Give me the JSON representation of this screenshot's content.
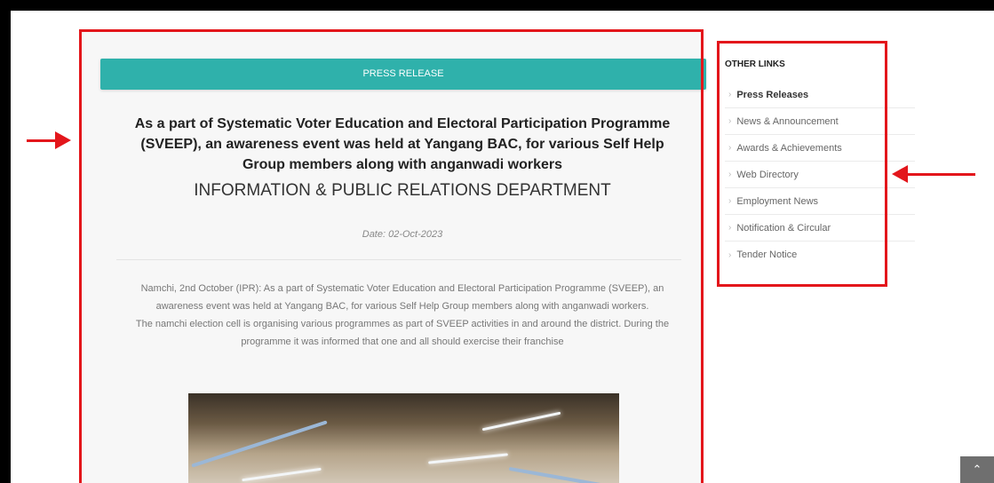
{
  "press": {
    "banner": "PRESS RELEASE",
    "headline": "As a part of Systematic Voter Education and Electoral Participation Programme (SVEEP), an awareness event was held at Yangang BAC, for various Self Help Group members along with anganwadi workers",
    "department": "INFORMATION & PUBLIC RELATIONS DEPARTMENT",
    "date": "Date: 02-Oct-2023",
    "paragraph1": "Namchi, 2nd October (IPR): As a part of Systematic Voter Education and Electoral Participation Programme (SVEEP), an awareness event was held at Yangang BAC, for various Self Help Group members along with anganwadi workers.",
    "paragraph2": "The namchi election cell is organising various programmes as part of SVEEP activities in and around the district. During the programme it was informed that one and all should exercise their franchise"
  },
  "sidebar": {
    "title": "OTHER LINKS",
    "items": [
      {
        "label": "Press Releases"
      },
      {
        "label": "News & Announcement"
      },
      {
        "label": "Awards & Achievements"
      },
      {
        "label": "Web Directory"
      },
      {
        "label": "Employment News"
      },
      {
        "label": "Notification & Circular"
      },
      {
        "label": "Tender Notice"
      }
    ]
  },
  "icons": {
    "chevron": "chevron-right-icon",
    "scroll_top": "chevron-up-icon"
  },
  "colors": {
    "accent": "#2fb1ab",
    "annotation": "#e3161b"
  }
}
